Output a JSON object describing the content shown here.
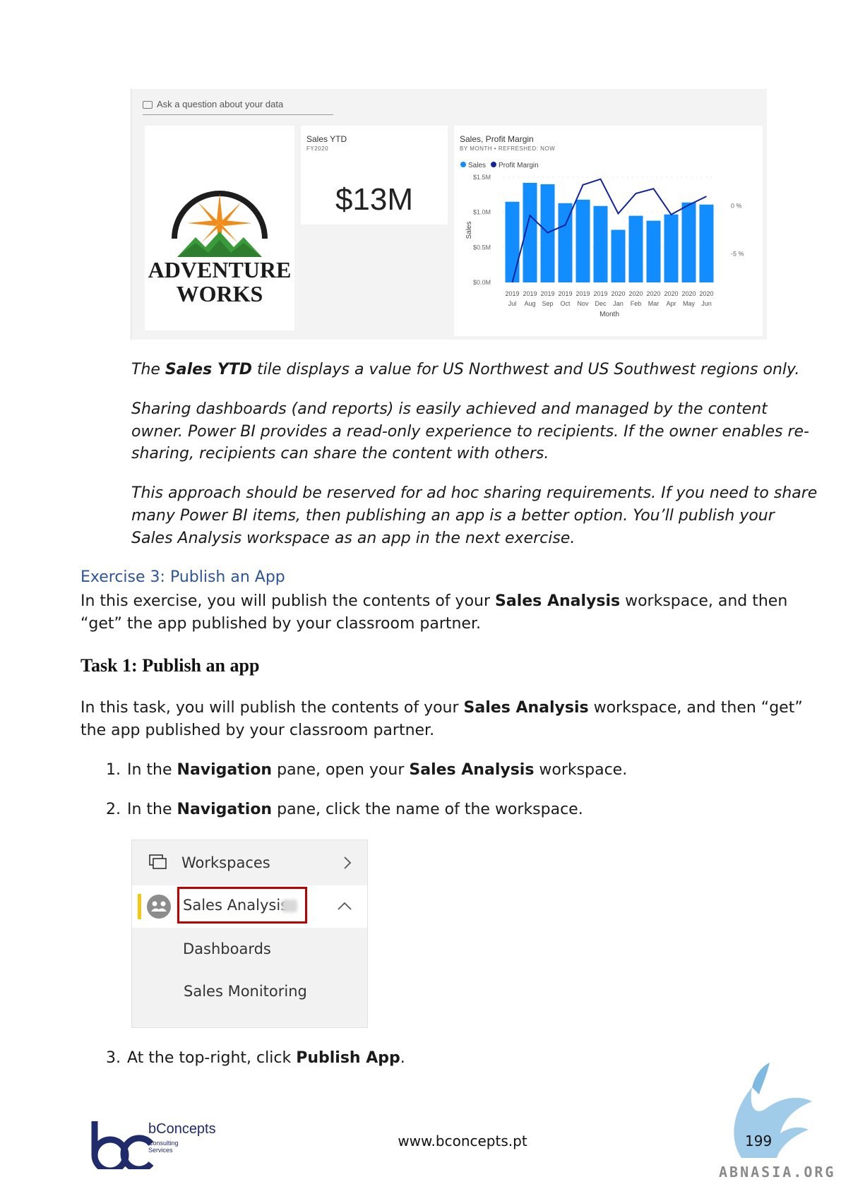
{
  "dashboard": {
    "qa_placeholder": "Ask a question about your data",
    "logo_line1": "ADVENTURE",
    "logo_line2": "WORKS",
    "ytd_title": "Sales YTD",
    "ytd_subtitle": "FY2020",
    "ytd_value": "$13M",
    "chart_title": "Sales, Profit Margin",
    "chart_subtitle": "BY MONTH  •  REFRESHED: NOW",
    "colors": {
      "bar": "#118dff",
      "line": "#12239e"
    }
  },
  "chart_data": {
    "type": "bar",
    "title": "Sales, Profit Margin",
    "xlabel": "Month",
    "ylabel": "Sales",
    "categories": [
      "2019 Jul",
      "2019 Aug",
      "2019 Sep",
      "2019 Oct",
      "2019 Nov",
      "2019 Dec",
      "2020 Jan",
      "2020 Feb",
      "2020 Mar",
      "2020 Apr",
      "2020 May",
      "2020 Jun"
    ],
    "years": [
      "2019",
      "2019",
      "2019",
      "2019",
      "2019",
      "2019",
      "2020",
      "2020",
      "2020",
      "2020",
      "2020",
      "2020"
    ],
    "months": [
      "Jul",
      "Aug",
      "Sep",
      "Oct",
      "Nov",
      "Dec",
      "Jan",
      "Feb",
      "Mar",
      "Apr",
      "May",
      "Jun"
    ],
    "series": [
      {
        "name": "Sales",
        "type": "bar",
        "axis": "left",
        "values": [
          1.15,
          1.42,
          1.4,
          1.13,
          1.18,
          1.09,
          0.75,
          0.95,
          0.88,
          0.97,
          1.14,
          1.11
        ]
      },
      {
        "name": "Profit Margin",
        "type": "line",
        "axis": "right",
        "values": [
          -8.0,
          -1.0,
          -2.8,
          -2.0,
          2.2,
          2.8,
          -0.8,
          1.3,
          1.8,
          -0.9,
          0.1,
          1.0
        ]
      }
    ],
    "ylim": [
      0,
      1.5
    ],
    "yticks": [
      "$0.0M",
      "$0.5M",
      "$1.0M",
      "$1.5M"
    ],
    "y2lim": [
      -8,
      3
    ],
    "y2ticks": [
      "0 %",
      "-5 %"
    ],
    "legend": "top-left"
  },
  "body": {
    "p1": [
      {
        "t": "The "
      },
      {
        "t": "Sales YTD",
        "b": true
      },
      {
        "t": " tile displays a value for US Northwest and US Southwest regions only."
      }
    ],
    "p2_l1": "Sharing dashboards (and reports) is easily achieved and managed by the content",
    "p2_l2": "owner. Power BI provides a read-only experience to recipients. If the owner enables re-",
    "p2_l3": "sharing, recipients can share the content with others.",
    "p3_l1": "This approach should be reserved for ad hoc sharing requirements. If you need to share",
    "p3_l2": "many Power BI items, then publishing an app is a better option. You’ll publish your",
    "p3_l3": "Sales Analysis workspace as an app in the next exercise.",
    "exercise_heading": "Exercise 3: Publish an App",
    "ex_l1": [
      {
        "t": "In this exercise, you will publish the contents of your "
      },
      {
        "t": "Sales Analysis",
        "b": true
      },
      {
        "t": " workspace, and then"
      }
    ],
    "ex_l2": "“get” the app published by your classroom partner.",
    "task_heading": "Task 1: Publish an app",
    "task_l1": [
      {
        "t": "In this task, you will publish the contents of your "
      },
      {
        "t": "Sales Analysis",
        "b": true
      },
      {
        "t": " workspace, and then “get”"
      }
    ],
    "task_l2": "the app published by your classroom partner.",
    "steps": [
      {
        "num": "1.",
        "parts": [
          {
            "t": "In the "
          },
          {
            "t": "Navigation",
            "b": true
          },
          {
            "t": " pane, open your "
          },
          {
            "t": "Sales Analysis",
            "b": true
          },
          {
            "t": " workspace."
          }
        ]
      },
      {
        "num": "2.",
        "parts": [
          {
            "t": "In the "
          },
          {
            "t": "Navigation",
            "b": true
          },
          {
            "t": " pane, click the name of the workspace."
          }
        ]
      },
      {
        "num": "3.",
        "parts": [
          {
            "t": "At the top-right, click "
          },
          {
            "t": "Publish App",
            "b": true
          },
          {
            "t": "."
          }
        ]
      }
    ]
  },
  "nav": {
    "workspaces": "Workspaces",
    "workspace_name": "Sales Analysis",
    "dashboards": "Dashboards",
    "sales_monitoring": "Sales Monitoring"
  },
  "footer": {
    "brand": "bConcepts",
    "brand_sub1": "Consulting",
    "brand_sub2": "Services",
    "url": "www.bconcepts.pt",
    "page": "199",
    "watermark": "ABNASIA.ORG"
  }
}
